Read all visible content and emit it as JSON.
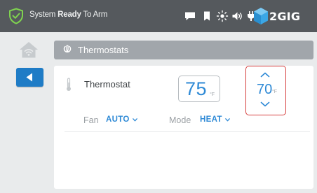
{
  "status_bar": {
    "message_prefix": "System",
    "message_emphasis": "Ready",
    "message_suffix": "To Arm",
    "brand": "2GIG",
    "icons": [
      "shield-check-icon",
      "message-icon",
      "bookmark-icon",
      "brightness-icon",
      "volume-icon",
      "plug-icon",
      "2gig-logo-icon"
    ],
    "shield_color": "#7fd34f"
  },
  "navigation": {
    "home_icon": "home-wifi-icon",
    "back_icon": "back-arrow-icon"
  },
  "breadcrumb": {
    "icon": "thermostat-icon",
    "label": "Thermostats"
  },
  "thermostat": {
    "name": "Thermostat",
    "current_temp": "75",
    "current_unit": "°F",
    "setpoint_temp": "70",
    "setpoint_unit": "°F",
    "fan_label": "Fan",
    "fan_value": "AUTO",
    "mode_label": "Mode",
    "mode_value": "HEAT"
  },
  "colors": {
    "status_bar": "#55595d",
    "accent": "#2f8ad6",
    "back_button": "#1f7cc6",
    "setpoint_border": "#d6403f",
    "breadcrumb": "#a1a6ab"
  }
}
